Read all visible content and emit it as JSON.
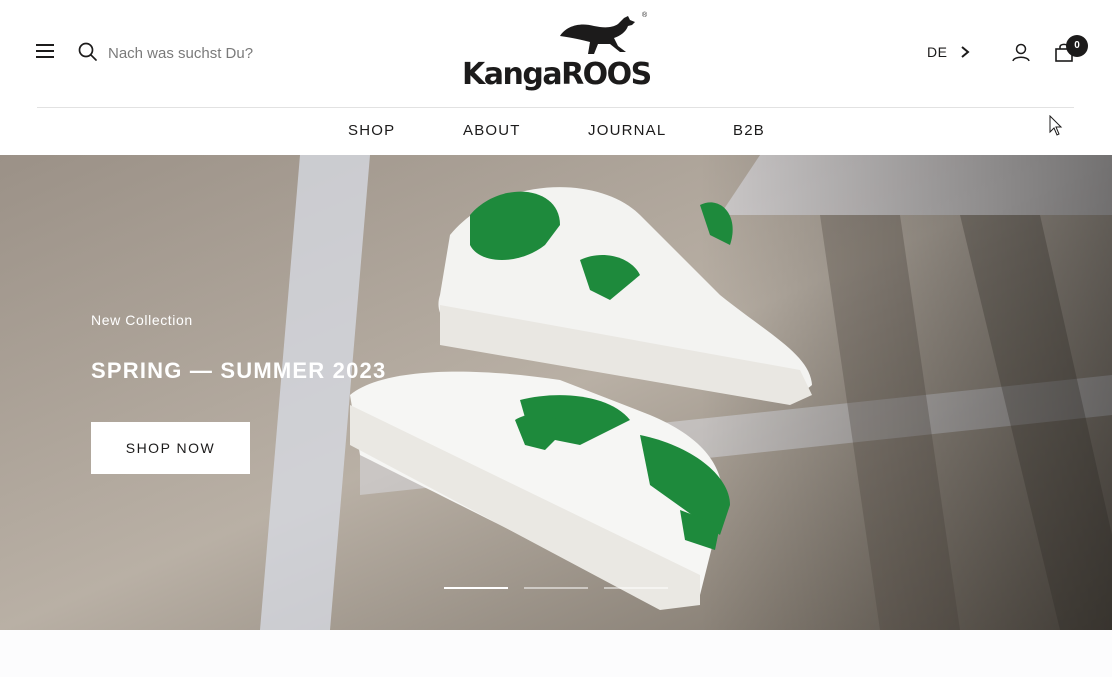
{
  "header": {
    "search": {
      "placeholder": "Nach was suchst Du?"
    },
    "logo": {
      "text": "KangaROOS",
      "registered": "®"
    },
    "language": "DE",
    "cart": {
      "count": "0"
    },
    "icons": {
      "menu": "hamburger-icon",
      "search": "search-icon",
      "language_next": "chevron-right-icon",
      "account": "user-icon",
      "cart": "shopping-bag-icon"
    }
  },
  "nav": {
    "items": [
      {
        "label": "SHOP"
      },
      {
        "label": "ABOUT"
      },
      {
        "label": "JOURNAL"
      },
      {
        "label": "B2B"
      }
    ]
  },
  "hero": {
    "eyebrow": "New Collection",
    "title": "SPRING — SUMMER 2023",
    "cta": "SHOP NOW",
    "slides_total": 3,
    "active_slide": 1
  },
  "colors": {
    "text": "#1c1b1b",
    "divider": "#e2e2e2",
    "shoe_accent": "#1e8a3c",
    "hero_text": "#ffffff"
  }
}
